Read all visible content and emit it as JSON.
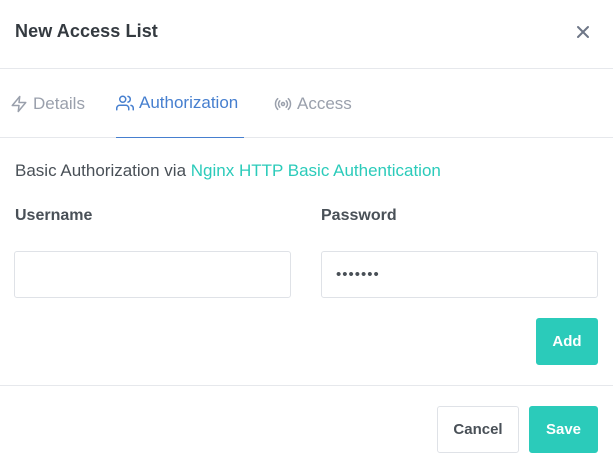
{
  "modal": {
    "title": "New Access List"
  },
  "tabs": [
    {
      "label": "Details",
      "icon": "lightning-icon",
      "active": false
    },
    {
      "label": "Authorization",
      "icon": "users-icon",
      "active": true
    },
    {
      "label": "Access",
      "icon": "broadcast-icon",
      "active": false
    }
  ],
  "authorization": {
    "description_prefix": "Basic Authorization via ",
    "description_link": "Nginx HTTP Basic Authentication",
    "username_label": "Username",
    "username_value": "",
    "password_label": "Password",
    "password_value": "•••••••",
    "add_label": "Add"
  },
  "footer": {
    "cancel_label": "Cancel",
    "save_label": "Save"
  },
  "colors": {
    "accent": "#2bcbba",
    "tab_active": "#467fcf",
    "tab_inactive": "#9aa0ac"
  }
}
